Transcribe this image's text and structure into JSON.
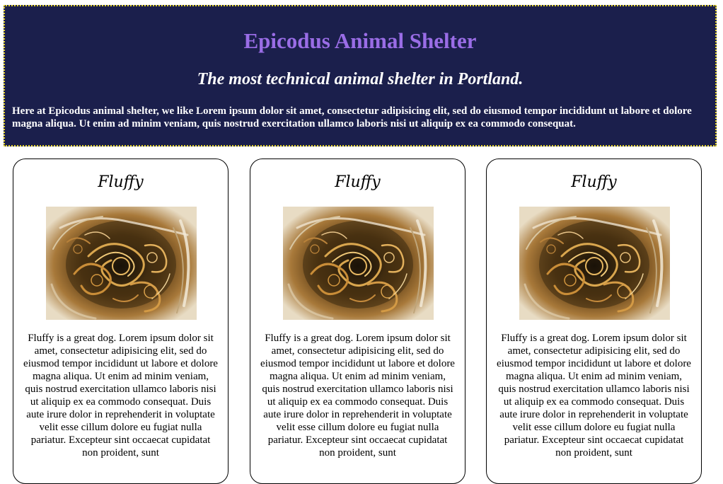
{
  "header": {
    "title": "Epicodus Animal Shelter",
    "tagline": "The most technical animal shelter in Portland.",
    "intro": "Here at Epicodus animal shelter, we like Lorem ipsum dolor sit amet, consectetur adipisicing elit, sed do eiusmod tempor incididunt ut labore et dolore magna aliqua. Ut enim ad minim veniam, quis nostrud exercitation ullamco laboris nisi ut aliquip ex ea commodo consequat."
  },
  "colors": {
    "header_bg": "#1b1f4c",
    "header_border": "#e6d52a",
    "title": "#9a6de6"
  },
  "pets": [
    {
      "name": "Fluffy",
      "description": "Fluffy is a great dog. Lorem ipsum dolor sit amet, consectetur adipisicing elit, sed do eiusmod tempor incididunt ut labore et dolore magna aliqua. Ut enim ad minim veniam, quis nostrud exercitation ullamco laboris nisi ut aliquip ex ea commodo consequat. Duis aute irure dolor in reprehenderit in voluptate velit esse cillum dolore eu fugiat nulla pariatur. Excepteur sint occaecat cupidatat non proident, sunt",
      "image_icon": "fractal-image"
    },
    {
      "name": "Fluffy",
      "description": "Fluffy is a great dog. Lorem ipsum dolor sit amet, consectetur adipisicing elit, sed do eiusmod tempor incididunt ut labore et dolore magna aliqua. Ut enim ad minim veniam, quis nostrud exercitation ullamco laboris nisi ut aliquip ex ea commodo consequat. Duis aute irure dolor in reprehenderit in voluptate velit esse cillum dolore eu fugiat nulla pariatur. Excepteur sint occaecat cupidatat non proident, sunt",
      "image_icon": "fractal-image"
    },
    {
      "name": "Fluffy",
      "description": "Fluffy is a great dog. Lorem ipsum dolor sit amet, consectetur adipisicing elit, sed do eiusmod tempor incididunt ut labore et dolore magna aliqua. Ut enim ad minim veniam, quis nostrud exercitation ullamco laboris nisi ut aliquip ex ea commodo consequat. Duis aute irure dolor in reprehenderit in voluptate velit esse cillum dolore eu fugiat nulla pariatur. Excepteur sint occaecat cupidatat non proident, sunt",
      "image_icon": "fractal-image"
    }
  ]
}
